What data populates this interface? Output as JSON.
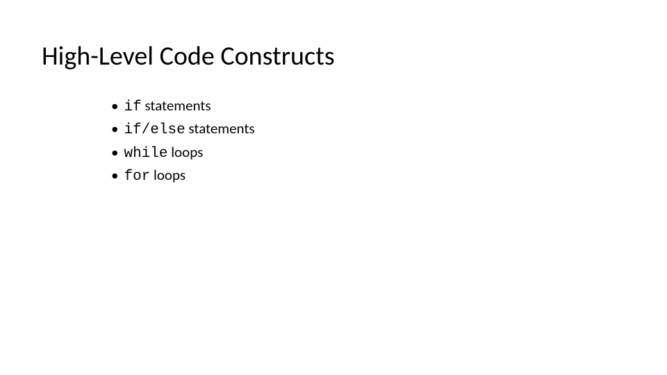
{
  "title": "High-Level Code Constructs",
  "bullets": [
    {
      "code": "if",
      "text": " statements"
    },
    {
      "code": "if/else",
      "text": " statements"
    },
    {
      "code": "while",
      "text": " loops"
    },
    {
      "code": "for",
      "text": " loops"
    }
  ]
}
